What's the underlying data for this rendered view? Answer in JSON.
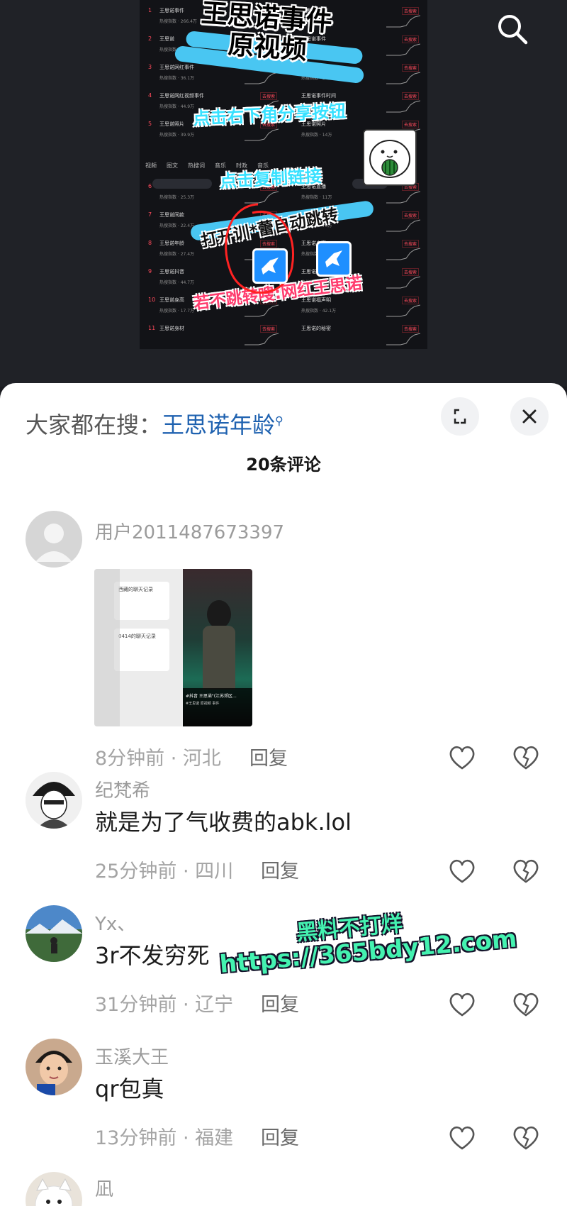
{
  "video": {
    "overlay_title_line1": "王思诺事件",
    "overlay_title_line2": "原视频",
    "instruction_share": "点击右下角分享按钮",
    "instruction_copy": "点击复制链接",
    "instruction_open": "打开训*蕾自动跳转",
    "instruction_fallback": "若不跳转嗖:网红王思诺",
    "tabs": [
      "视频",
      "图文",
      "热搜词",
      "音乐",
      "时政",
      "音乐"
    ],
    "list_left": [
      {
        "rank": "1",
        "title": "王思诺事件",
        "sub": "热搜指数 · 266.4万"
      },
      {
        "rank": "2",
        "title": "王思诺",
        "sub": "热搜指数 · 92.1万"
      },
      {
        "rank": "3",
        "title": "王思诺网红事件",
        "sub": "热搜指数 · 36.1万"
      },
      {
        "rank": "4",
        "title": "王思诺网红视频事件",
        "sub": "热搜指数 · 44.9万"
      },
      {
        "rank": "5",
        "title": "王思诺照片",
        "sub": "热搜指数 · 39.9万"
      },
      {
        "rank": "6",
        "title": "王思诺原视",
        "sub": "热搜指数 · 25.3万"
      },
      {
        "rank": "7",
        "title": "王思诺同款",
        "sub": "热搜指数 · 22.4万"
      },
      {
        "rank": "8",
        "title": "王思诺年龄",
        "sub": "热搜指数 · 27.4万"
      },
      {
        "rank": "9",
        "title": "王思诺抖音",
        "sub": "热搜指数 · 44.7万"
      },
      {
        "rank": "10",
        "title": "王思诺身高",
        "sub": "热搜指数 · 17.7万"
      },
      {
        "rank": "11",
        "title": "王思诺身材",
        "sub": ""
      }
    ],
    "list_right": [
      {
        "rank": "",
        "title": "王思诺原视",
        "sub": ""
      },
      {
        "rank": "",
        "title": "王思诺事件",
        "sub": "热搜指数 · 18万"
      },
      {
        "rank": "",
        "title": "王思诺资料",
        "sub": "热搜指数 · 26万"
      },
      {
        "rank": "",
        "title": "王思诺事件时间",
        "sub": "热搜指数 · 28万"
      },
      {
        "rank": "",
        "title": "王思诺照片",
        "sub": "热搜指数 · 14万"
      },
      {
        "rank": "",
        "title": "王思诺直播",
        "sub": "热搜指数 · 11万"
      },
      {
        "rank": "",
        "title": "王思诺原声",
        "sub": "热搜指数 · 76万"
      },
      {
        "rank": "",
        "title": "王思诺身高",
        "sub": "热搜指数 · 18万"
      },
      {
        "rank": "",
        "title": "王思诺视频",
        "sub": "热搜指数 · 33万"
      },
      {
        "rank": "",
        "title": "王思诺福声明",
        "sub": "热搜指数 · 42.1万"
      },
      {
        "rank": "",
        "title": "王思诺的秘密",
        "sub": ""
      }
    ],
    "tag_label": "去搜索"
  },
  "sheet": {
    "search_prefix": "大家都在搜：",
    "search_keyword": "王思诺年龄",
    "search_suffix_icon": "search-small-icon",
    "comment_count": "20条评论"
  },
  "comments": [
    {
      "user": "用户2011487673397",
      "text": "",
      "time": "8分钟前 · 河北",
      "reply": "回复",
      "has_image": true,
      "image": {
        "line1": "西藏的聊天记录",
        "line2": "0414的聊天记录",
        "caption": "#抖音 王思诺\"(江苏郊区...",
        "caption2": "#王思诺 原视频 事件"
      }
    },
    {
      "user": "纪梵希",
      "text": "就是为了气收费的abk.lol",
      "time": "25分钟前 · 四川",
      "reply": "回复",
      "has_image": false
    },
    {
      "user": "Yx、",
      "text": "3r不发穷死",
      "time": "31分钟前 · 辽宁",
      "reply": "回复",
      "has_image": false
    },
    {
      "user": "玉溪大王",
      "text": "qr包真",
      "time": "13分钟前 · 福建",
      "reply": "回复",
      "has_image": false
    },
    {
      "user": "凪",
      "text": "",
      "time": "",
      "reply": "",
      "has_image": false
    }
  ],
  "watermark": {
    "line1": "黑料不打烊",
    "line2": "https://365bdy12.com"
  },
  "colors": {
    "keyword_blue": "#1f62b0",
    "watermark_green": "#44f2b0",
    "overlay_cyan": "#38e1ff",
    "overlay_pink": "#ff3c6e"
  }
}
